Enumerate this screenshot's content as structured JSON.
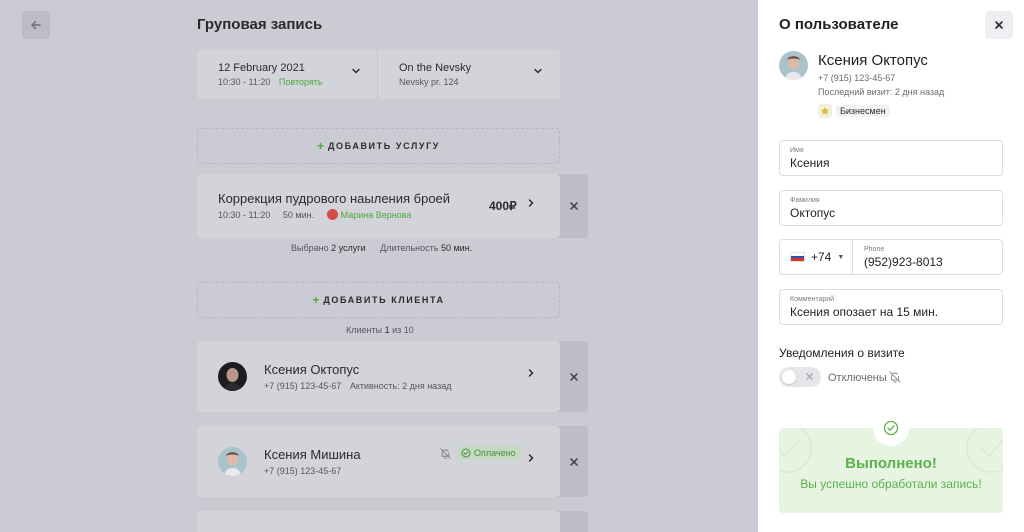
{
  "page": {
    "title": "Груповая запись",
    "datetime": {
      "date": "12 February 2021",
      "time": "10:30 - 11:20",
      "repeat": "Повторять"
    },
    "location": {
      "name": "On the Nevsky",
      "address": "Nevsky pr. 124"
    },
    "add_service": "ДОБАВИТЬ УСЛУГУ",
    "service": {
      "title": "Коррекция пудрового наыления броей",
      "time": "10:30 - 11:20",
      "duration": "50 мин.",
      "master": "Марина Вернова",
      "price": "400₽"
    },
    "summary": {
      "selected_label": "Выбрано",
      "selected_value": "2 услуги",
      "duration_label": "Длительность",
      "duration_value": "50 мин."
    },
    "add_client": "ДОБАВИТЬ КЛИЕНТА",
    "clients_count": {
      "label": "Клиенты",
      "value": "1",
      "of": "из 10"
    },
    "clients": [
      {
        "name": "Ксения Октопус",
        "phone": "+7 (915) 123-45-67",
        "activity": "Активность: 2 дня назад"
      },
      {
        "name": "Ксения Мишина",
        "phone": "+7 (915) 123-45-67",
        "badge": "Оплачено"
      }
    ]
  },
  "panel": {
    "title": "О пользователе",
    "user": {
      "name": "Ксения Октопус",
      "phone": "+7 (915) 123-45-67",
      "last_visit": "Последний визит: 2 дня назад",
      "tag": "Бизнесмен"
    },
    "fields": {
      "first_name": {
        "label": "Имя",
        "value": "Ксения"
      },
      "last_name": {
        "label": "Фамилия",
        "value": "Октопус"
      },
      "phone": {
        "country_code": "+74",
        "label": "Phone",
        "value": "(952)923-8013"
      },
      "comment": {
        "label": "Комментарий",
        "value": "Ксения опозает на 15 мин."
      }
    },
    "notifications": {
      "title": "Уведомления о визите",
      "state": "Отключены",
      "enabled": false
    },
    "success": {
      "title": "Выполнено!",
      "text": "Вы успешно обработали запись!"
    }
  },
  "colors": {
    "accent_green": "#5bb14a",
    "danger_red": "#d64a48",
    "overlay": "#cbcbd3",
    "panel_bg": "#ffffff"
  }
}
